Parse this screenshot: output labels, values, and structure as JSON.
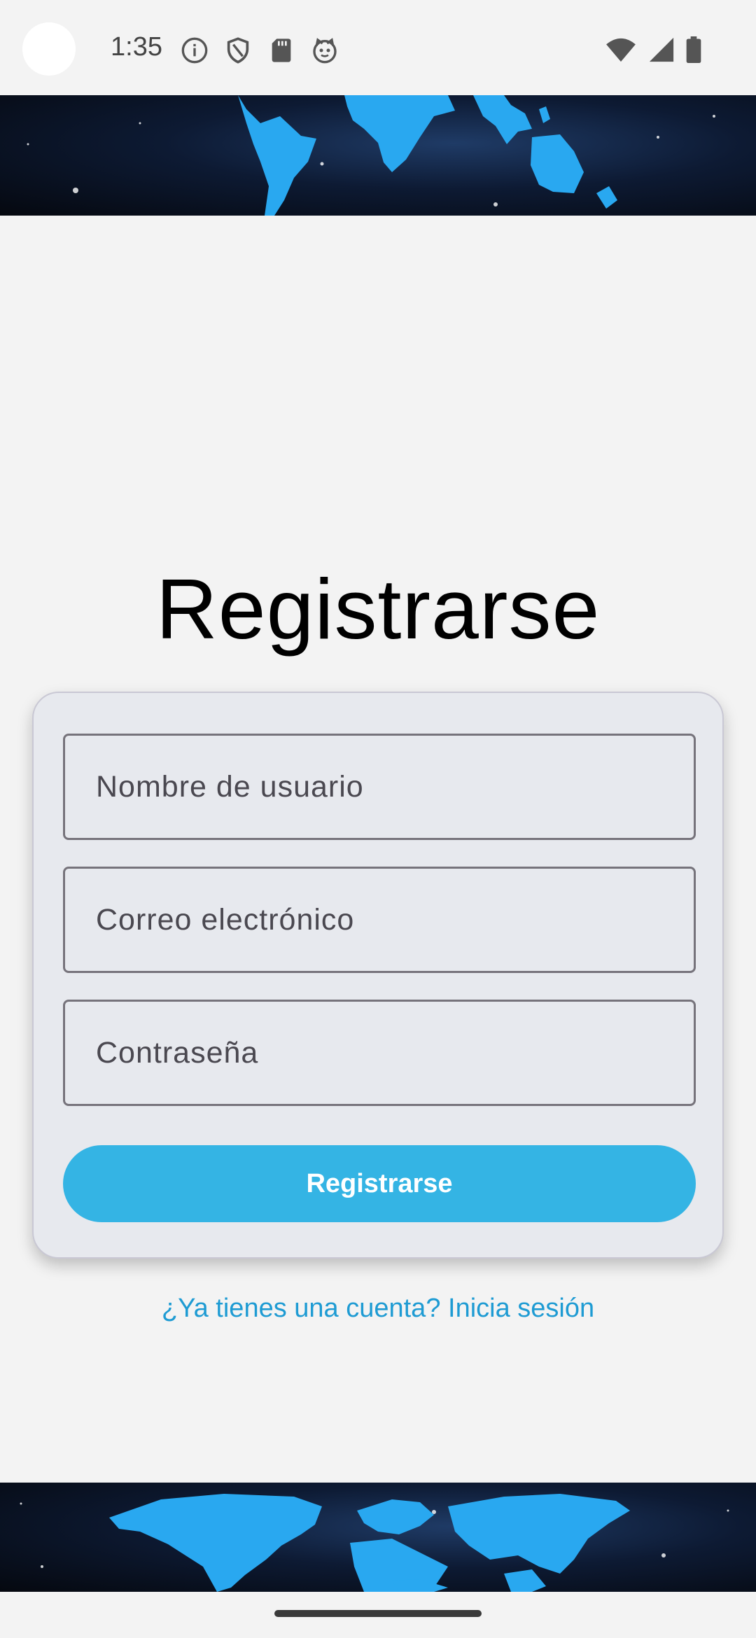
{
  "status_bar": {
    "time": "1:35",
    "icons": [
      "info-icon",
      "shield-icon",
      "sd-card-icon",
      "cat-face-icon",
      "wifi-icon",
      "signal-icon",
      "battery-icon"
    ]
  },
  "register": {
    "title": "Registrarse",
    "username_placeholder": "Nombre de usuario",
    "email_placeholder": "Correo electrónico",
    "password_placeholder": "Contraseña",
    "submit_label": "Registrarse",
    "login_link": "¿Ya tienes una cuenta? Inicia sesión"
  },
  "colors": {
    "accent": "#34b4e4",
    "link": "#1e9bd3",
    "background": "#f3f3f3",
    "card": "#e7e9ee"
  }
}
